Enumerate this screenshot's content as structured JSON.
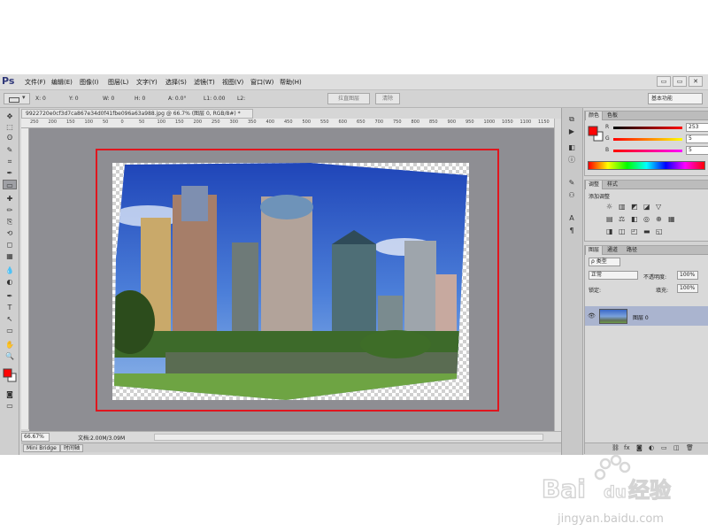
{
  "app": {
    "logo": "Ps"
  },
  "menu": [
    "文件(F)",
    "编辑(E)",
    "图像(I)",
    "图层(L)",
    "文字(Y)",
    "选择(S)",
    "滤镜(T)",
    "视图(V)",
    "窗口(W)",
    "帮助(H)"
  ],
  "window_controls": [
    "▭",
    "▭",
    "✕"
  ],
  "options": {
    "x": "X: 0",
    "y": "Y: 0",
    "w": "W: 0",
    "h": "H: 0",
    "a": "A: 0.0°",
    "l1": "L1: 0.00",
    "l2": "L2:",
    "straighten_btn": "拉直图层",
    "clear_btn": "清除",
    "workspace": "基本功能"
  },
  "tools": [
    "move-icon",
    "marquee-icon",
    "lasso-icon",
    "quick-select-icon",
    "crop-icon",
    "eyedropper-icon",
    "ruler-icon",
    "healing-icon",
    "brush-icon",
    "clone-icon",
    "history-brush-icon",
    "eraser-icon",
    "gradient-icon",
    "blur-icon",
    "dodge-icon",
    "pen-icon",
    "type-icon",
    "path-select-icon",
    "shape-icon",
    "hand-icon",
    "zoom-icon"
  ],
  "tool_glyphs": [
    "✥",
    "⬚",
    "ʘ",
    "✎",
    "⌗",
    "✒",
    "▭",
    "✚",
    "✏",
    "⎘",
    "⟲",
    "◻",
    "▦",
    "💧",
    "◐",
    "✒",
    "T",
    "↖",
    "▭",
    "✋",
    "🔍"
  ],
  "document": {
    "tab_title": "9922720e0cf3d7ca867e34d0f41fbe096a63a988.jpg @ 66.7% (图层 0, RGB/8#) *",
    "tab_close": "×",
    "ruler_ticks": [
      "250",
      "200",
      "150",
      "100",
      "50",
      "0",
      "50",
      "100",
      "150",
      "200",
      "250",
      "300",
      "350",
      "400",
      "450",
      "500",
      "550",
      "600",
      "650",
      "700",
      "750",
      "800",
      "850",
      "900",
      "950",
      "1000",
      "1050",
      "1100",
      "1150"
    ],
    "zoom": "66.67%",
    "doc_info": "文档:2.00M/3.09M"
  },
  "bottom_tabs": [
    "Mini Bridge",
    "时间轴"
  ],
  "colors": {
    "tabs": [
      "颜色",
      "色板"
    ],
    "r_label": "R",
    "g_label": "G",
    "b_label": "B",
    "r": "253",
    "g": "5",
    "b": "5",
    "foreground": "#fd0505"
  },
  "adjustments": {
    "tabs": [
      "调整",
      "样式"
    ],
    "title": "添加调整"
  },
  "layers": {
    "tabs": [
      "图层",
      "通道",
      "路径"
    ],
    "filter": "ρ 类型",
    "blend_mode": "正常",
    "opacity_label": "不透明度:",
    "opacity": "100%",
    "lock_label": "锁定:",
    "fill_label": "填充:",
    "fill": "100%",
    "layer_name": "图层 0"
  },
  "watermark": {
    "brand": "Bai",
    "brand2": "du",
    "brand_cn": "经验",
    "url": "jingyan.baidu.com"
  }
}
